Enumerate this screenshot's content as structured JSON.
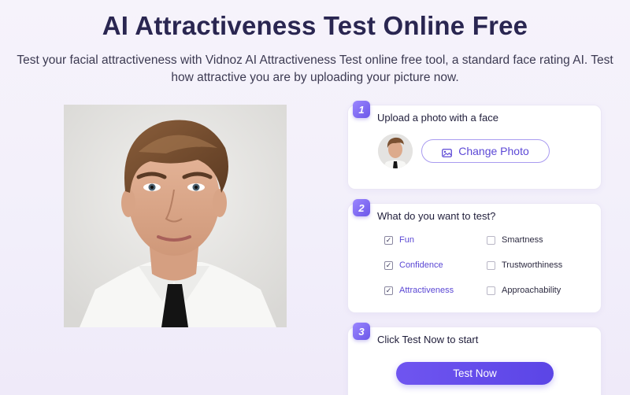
{
  "header": {
    "title": "AI Attractiveness Test Online Free",
    "subtitle": "Test your facial attractiveness with Vidnoz AI Attractiveness Test online free tool, a standard face rating AI. Test how attractive you are by uploading your picture now."
  },
  "step1": {
    "number": "1",
    "heading": "Upload a photo with a face",
    "button_label": "Change Photo",
    "button_icon": "image-icon"
  },
  "step2": {
    "number": "2",
    "heading": "What do you want to test?",
    "options": [
      {
        "label": "Fun",
        "checked": true
      },
      {
        "label": "Smartness",
        "checked": false
      },
      {
        "label": "Confidence",
        "checked": true
      },
      {
        "label": "Trustworthiness",
        "checked": false
      },
      {
        "label": "Attractiveness",
        "checked": true
      },
      {
        "label": "Approachability",
        "checked": false
      }
    ]
  },
  "step3": {
    "number": "3",
    "heading": "Click Test Now to start",
    "button_label": "Test Now"
  },
  "colors": {
    "accent": "#5c48d6",
    "title": "#2a2651",
    "button_gradient_start": "#6f55f0",
    "button_gradient_end": "#5b45e6"
  }
}
